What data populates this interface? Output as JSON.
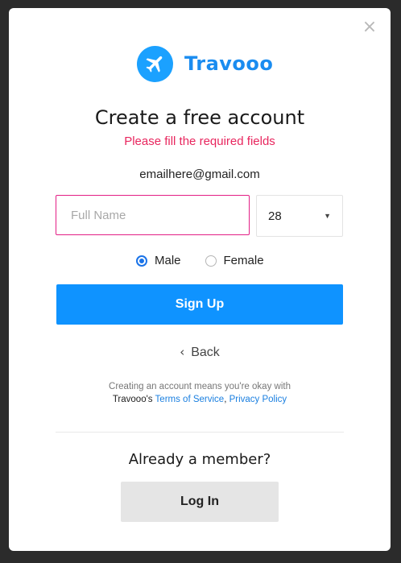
{
  "modal": {
    "close_icon": "×",
    "brand_name": "Travooo",
    "brand_color": "#1ba1ff",
    "title": "Create a free account",
    "error": "Please fill the required fields",
    "error_color": "#e8265e",
    "email": "emailhere@gmail.com"
  },
  "form": {
    "full_name": {
      "value": "",
      "placeholder": "Full Name"
    },
    "age": {
      "value": "28"
    },
    "gender": {
      "options": [
        {
          "label": "Male",
          "checked": true
        },
        {
          "label": "Female",
          "checked": false
        }
      ]
    },
    "signup_label": "Sign Up",
    "primary_color": "#0f93ff"
  },
  "back_label": "Back",
  "terms": {
    "line1": "Creating an account means you're okay with",
    "prefix": "Travooo's",
    "tos": "Terms of Service",
    "separator": ",",
    "privacy": "Privacy Policy"
  },
  "footer": {
    "member_text": "Already a member?",
    "login_label": "Log In"
  }
}
